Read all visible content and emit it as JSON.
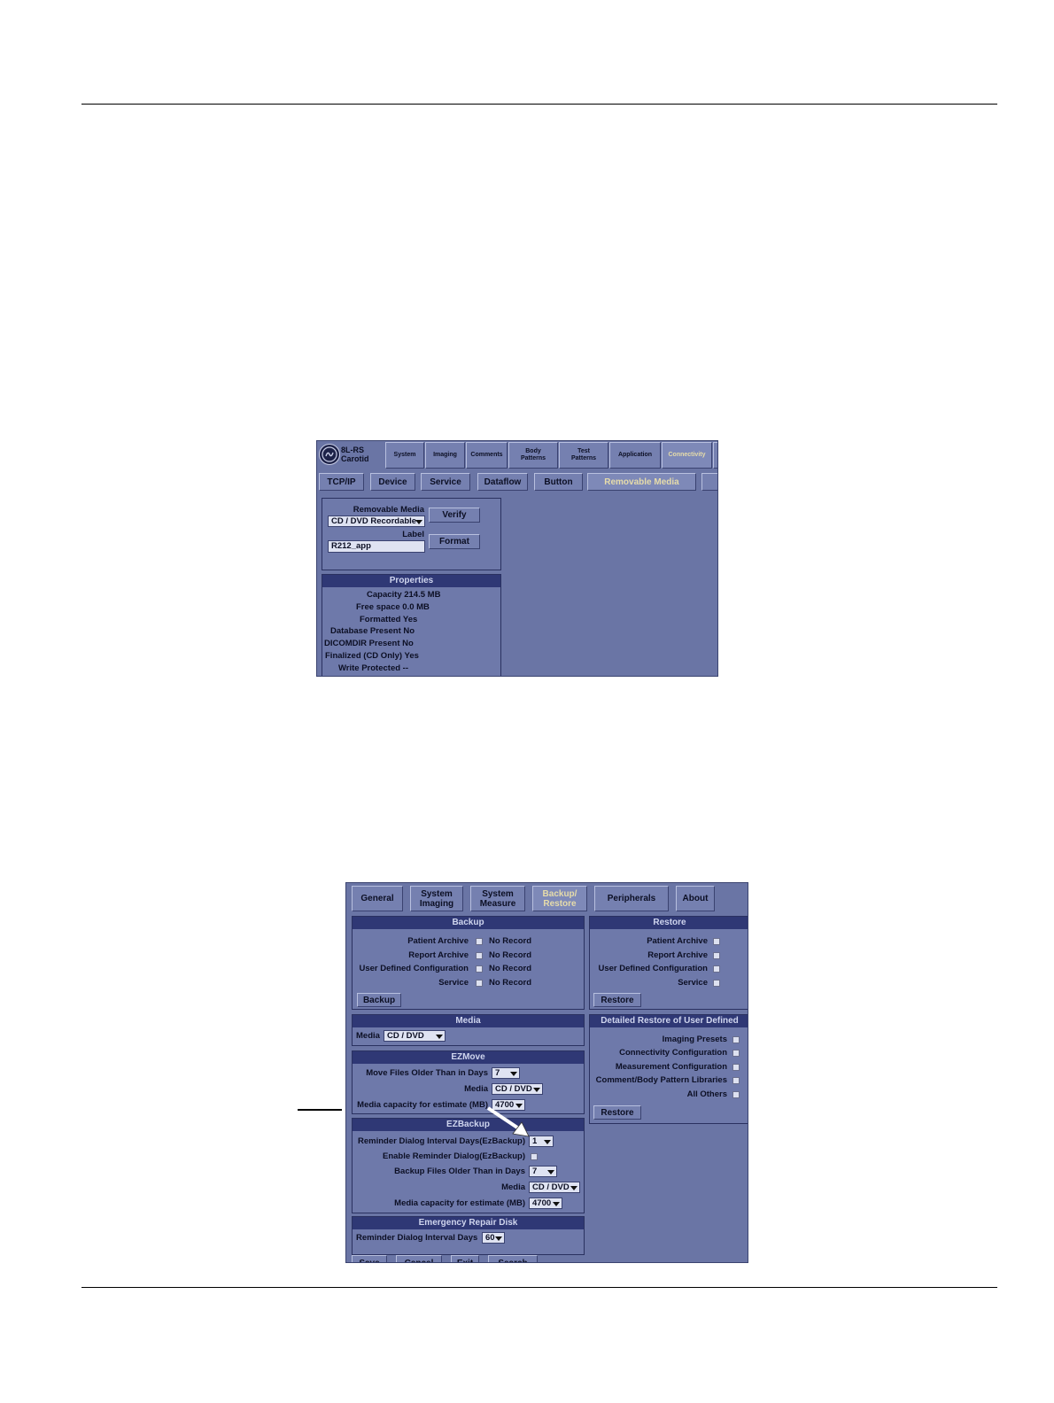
{
  "shot1": {
    "logo_line1": "8L-RS",
    "logo_line2": "Carotid",
    "top_tabs": [
      {
        "label": "System"
      },
      {
        "label": "Imaging"
      },
      {
        "label": "Comments"
      },
      {
        "label": "Body Patterns"
      },
      {
        "label": "Test Patterns"
      },
      {
        "label": "Application"
      },
      {
        "label": "Connectivity"
      }
    ],
    "sub_tabs": [
      {
        "label": "TCP/IP"
      },
      {
        "label": "Device"
      },
      {
        "label": "Service"
      },
      {
        "label": "Dataflow"
      },
      {
        "label": "Button"
      },
      {
        "label": "Removable Media"
      }
    ],
    "removable_media_label": "Removable Media",
    "media_value": "CD / DVD Recordable",
    "label_label": "Label",
    "label_value": "R212_app",
    "verify_button": "Verify",
    "format_button": "Format",
    "properties_header": "Properties",
    "properties": [
      "Capacity 214.5 MB",
      "Free space 0.0 MB",
      "Formatted Yes",
      "Database Present No",
      "DICOMDIR Present No",
      "Finalized (CD Only) Yes",
      "Write Protected --"
    ]
  },
  "shot2": {
    "tabs": [
      {
        "label": "General"
      },
      {
        "label": "System Imaging"
      },
      {
        "label": "System Measure"
      },
      {
        "label": "Backup/ Restore"
      },
      {
        "label": "Peripherals"
      },
      {
        "label": "About"
      }
    ],
    "backup": {
      "header": "Backup",
      "rows": [
        {
          "label": "Patient Archive",
          "status": "No Record"
        },
        {
          "label": "Report Archive",
          "status": "No Record"
        },
        {
          "label": "User Defined Configuration",
          "status": "No Record"
        },
        {
          "label": "Service",
          "status": "No Record"
        }
      ],
      "button": "Backup"
    },
    "restore": {
      "header": "Restore",
      "rows": [
        "Patient Archive",
        "Report Archive",
        "User Defined Configuration",
        "Service"
      ],
      "button": "Restore"
    },
    "media": {
      "header": "Media",
      "label": "Media",
      "value": "CD / DVD"
    },
    "detailed": {
      "header": "Detailed Restore of User Defined",
      "rows": [
        "Imaging Presets",
        "Connectivity Configuration",
        "Measurement Configuration",
        "Comment/Body Pattern Libraries",
        "All Others"
      ],
      "button": "Restore"
    },
    "ezmove": {
      "header": "EZMove",
      "move_label": "Move Files Older Than in Days",
      "move_value": "7",
      "media_label": "Media",
      "media_value": "CD / DVD",
      "capacity_label": "Media capacity for estimate (MB)",
      "capacity_value": "4700"
    },
    "ezbackup": {
      "header": "EZBackup",
      "reminder_label": "Reminder Dialog Interval Days(EzBackup)",
      "reminder_value": "1",
      "enable_label": "Enable Reminder Dialog(EzBackup)",
      "backup_label": "Backup Files Older Than in Days",
      "backup_value": "7",
      "media_label": "Media",
      "media_value": "CD / DVD",
      "capacity_label": "Media capacity for estimate (MB)",
      "capacity_value": "4700"
    },
    "erd": {
      "header": "Emergency Repair Disk",
      "reminder_label": "Reminder Dialog Interval Days",
      "reminder_value": "60"
    },
    "bottom_buttons": [
      "Save",
      "Cancel",
      "Exit",
      "Search"
    ]
  }
}
